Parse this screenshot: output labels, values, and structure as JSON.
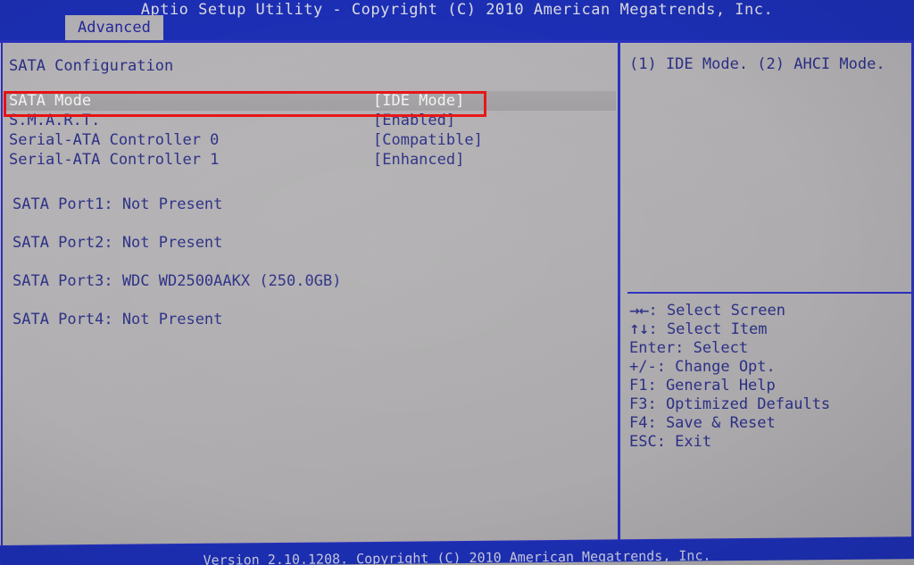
{
  "header": {
    "title": "Aptio Setup Utility - Copyright (C) 2010 American Megatrends, Inc.",
    "active_tab": "Advanced"
  },
  "left_panel": {
    "section_title": "SATA Configuration",
    "options": [
      {
        "label": "SATA Mode",
        "value": "[IDE Mode]",
        "selected": true
      },
      {
        "label": "S.M.A.R.T.",
        "value": "[Enabled]",
        "selected": false
      },
      {
        "label": "Serial-ATA Controller 0",
        "value": "[Compatible]",
        "selected": false
      },
      {
        "label": "Serial-ATA Controller 1",
        "value": "[Enhanced]",
        "selected": false
      }
    ],
    "port_info": [
      {
        "text": "SATA Port1: Not Present"
      },
      {
        "text": "SATA Port2: Not Present"
      },
      {
        "text": "SATA Port3: WDC WD2500AAKX (250.0GB)"
      },
      {
        "text": "SATA Port4: Not Present"
      }
    ]
  },
  "right_panel": {
    "help_text": "(1) IDE Mode. (2) AHCI Mode.",
    "keys": [
      {
        "glyph": "→←",
        "text": ": Select Screen"
      },
      {
        "glyph": "↑↓",
        "text": ": Select Item"
      },
      {
        "glyph": "",
        "text": "Enter: Select"
      },
      {
        "glyph": "",
        "text": "+/-: Change Opt."
      },
      {
        "glyph": "",
        "text": "F1: General Help"
      },
      {
        "glyph": "",
        "text": "F3: Optimized Defaults"
      },
      {
        "glyph": "",
        "text": "F4: Save & Reset"
      },
      {
        "glyph": "",
        "text": "ESC: Exit"
      }
    ]
  },
  "footer": {
    "text": "Version 2.10.1208. Copyright (C) 2010 American Megatrends, Inc."
  },
  "annotation": {
    "target": "SATA Mode",
    "color": "#e81212"
  }
}
